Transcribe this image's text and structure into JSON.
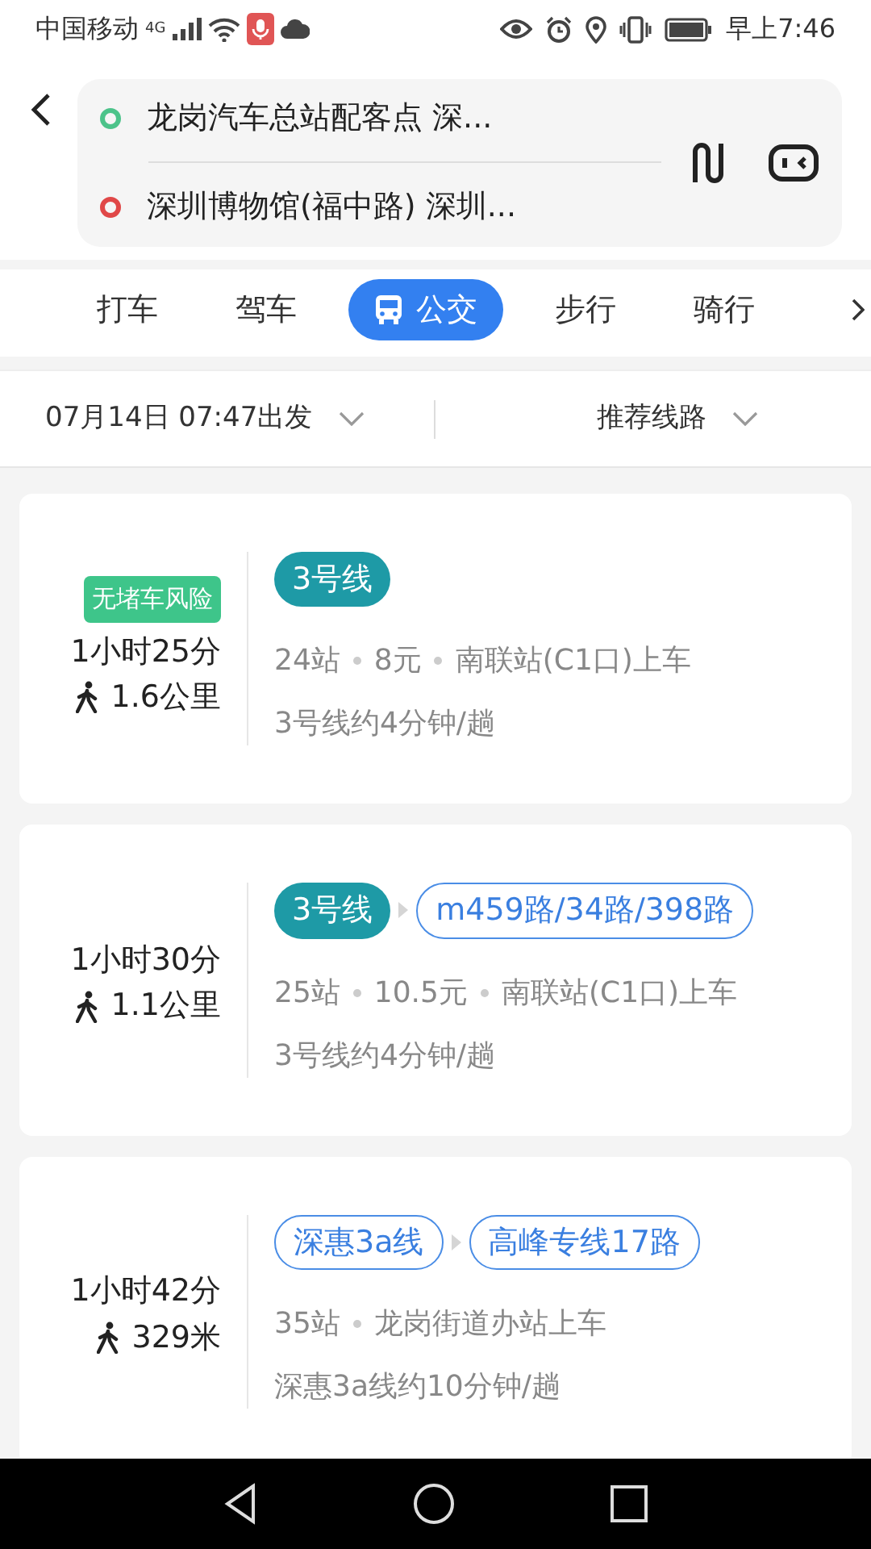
{
  "status_bar": {
    "carrier": "中国移动",
    "network": "4G",
    "time": "早上7:46"
  },
  "route": {
    "origin": "龙岗汽车总站配客点 深...",
    "destination": "深圳博物馆(福中路) 深圳..."
  },
  "tabs": [
    {
      "label": "打车",
      "selected": false,
      "kind": "text"
    },
    {
      "label": "驾车",
      "selected": false,
      "kind": "text"
    },
    {
      "label": "公交",
      "selected": true,
      "kind": "bus"
    },
    {
      "label": "步行",
      "selected": false,
      "kind": "text"
    },
    {
      "label": "骑行",
      "selected": false,
      "kind": "text"
    }
  ],
  "filters": {
    "departure": "07月14日 07:47出发",
    "sort": "推荐线路"
  },
  "plans": [
    {
      "tag": "无堵车风险",
      "duration": "1小时25分",
      "walk": "1.6公里",
      "lines": [
        {
          "name": "3号线",
          "kind": "subway"
        }
      ],
      "info": [
        "24站",
        "8元",
        "南联站(C1口)上车"
      ],
      "frequency": "3号线约4分钟/趟"
    },
    {
      "duration": "1小时30分",
      "walk": "1.1公里",
      "lines": [
        {
          "name": "3号线",
          "kind": "subway"
        },
        {
          "name": "m459路/34路/398路",
          "kind": "bus"
        }
      ],
      "info": [
        "25站",
        "10.5元",
        "南联站(C1口)上车"
      ],
      "frequency": "3号线约4分钟/趟"
    },
    {
      "duration": "1小时42分",
      "walk": "329米",
      "lines": [
        {
          "name": "深惠3a线",
          "kind": "bus"
        },
        {
          "name": "高峰专线17路",
          "kind": "bus"
        }
      ],
      "info": [
        "35站",
        "龙岗街道办站上车"
      ],
      "frequency": "深惠3a线约10分钟/趟"
    }
  ]
}
